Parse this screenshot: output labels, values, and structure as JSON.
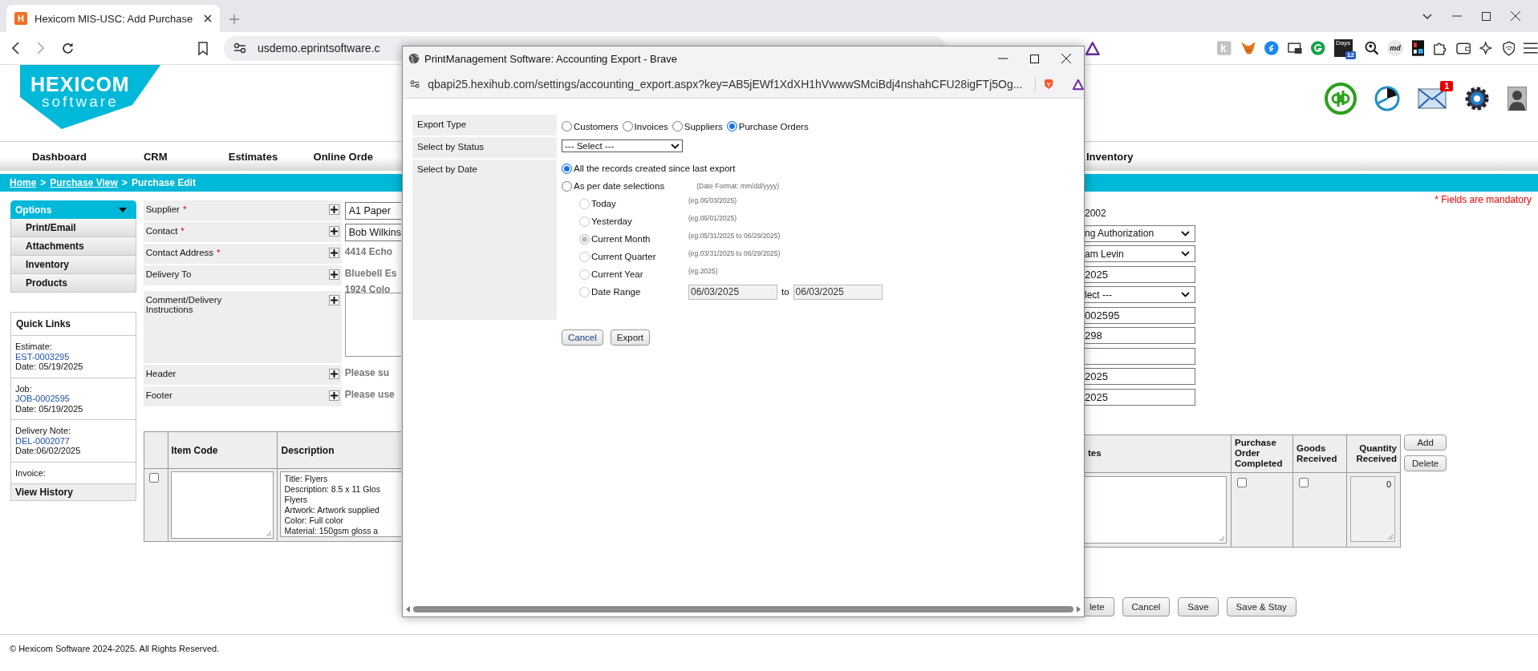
{
  "browser": {
    "tab": {
      "favicon_letter": "H",
      "title": "Hexicom MIS-USC: Add Purchase"
    },
    "address": "usdemo.eprintsoftware.c",
    "extensions": {
      "days_text": "Days",
      "days_badge": "12",
      "md_text": "md"
    }
  },
  "header": {
    "logo_line1": "HEXICOM",
    "logo_line2": "software",
    "mail_badge": "1"
  },
  "nav": [
    {
      "label": "Dashboard"
    },
    {
      "label": "CRM"
    },
    {
      "label": "Estimates"
    },
    {
      "label": "Online Orde"
    },
    {
      "label": "Inventory"
    }
  ],
  "breadcrumb": {
    "separator": ">",
    "items": [
      {
        "label": "Home",
        "link": true
      },
      {
        "label": "Purchase View",
        "link": true
      },
      {
        "label": "Purchase Edit",
        "link": false
      }
    ]
  },
  "options": {
    "title": "Options",
    "items": [
      "Print/Email",
      "Attachments",
      "Inventory",
      "Products"
    ]
  },
  "quick_links": {
    "title": "Quick Links",
    "entries": [
      {
        "label": "Estimate:",
        "link": "EST-0003295",
        "date": "Date: 05/19/2025"
      },
      {
        "label": "Job:",
        "link": "JOB-0002595",
        "date": "Date: 05/19/2025"
      },
      {
        "label": "Delivery Note:",
        "link": "DEL-0002077",
        "date": "Date:06/02/2025"
      },
      {
        "label": "Invoice:"
      }
    ],
    "footer": "View History"
  },
  "form": {
    "required_mark": "*",
    "rows": [
      {
        "label": "Supplier",
        "required": true,
        "kind": "input",
        "value": "A1 Paper"
      },
      {
        "label": "Contact",
        "required": true,
        "kind": "input",
        "value": "Bob Wilkins"
      },
      {
        "label": "Contact Address",
        "required": true,
        "kind": "text",
        "lines": [
          "4414 Echo"
        ]
      },
      {
        "label": "Delivery To",
        "required": false,
        "kind": "text",
        "lines": [
          "Bluebell Es",
          "1924 Colo"
        ]
      },
      {
        "label": "Comment/Delivery Instructions",
        "required": false,
        "kind": "textarea"
      },
      {
        "label": "Header",
        "required": false,
        "kind": "hint",
        "lines": [
          "Please su"
        ]
      },
      {
        "label": "Footer",
        "required": false,
        "kind": "hint",
        "lines": [
          "Please use"
        ]
      }
    ]
  },
  "mandatory_note": "* Fields are mandatory",
  "right_fields": [
    {
      "kind": "text",
      "value": "2002"
    },
    {
      "kind": "select",
      "value": "ng Authorization"
    },
    {
      "kind": "select",
      "value": "am Levin"
    },
    {
      "kind": "input",
      "value": "2025"
    },
    {
      "kind": "select",
      "value": "lect ---"
    },
    {
      "kind": "input",
      "value": "002595"
    },
    {
      "kind": "input",
      "value": "298"
    },
    {
      "kind": "input"
    },
    {
      "kind": "input",
      "value": "2025"
    },
    {
      "kind": "input",
      "value": "2025"
    }
  ],
  "items_table": {
    "columns_left": [
      "Item Code",
      "Description"
    ],
    "columns_right": [
      "tes",
      "Purchase Order Completed",
      "Goods Received",
      "Quantity Received"
    ],
    "rows": [
      {
        "selected": false,
        "description_lines": [
          "Title: Flyers",
          "Description: 8.5 x 11 Glos",
          "Flyers",
          "Artwork: Artwork supplied",
          "Color: Full color",
          "Material: 150gsm gloss a"
        ],
        "po_completed": false,
        "goods_received": false,
        "quantity_received": "0"
      }
    ],
    "buttons": [
      "Add",
      "Delete"
    ]
  },
  "page_buttons": [
    "lete",
    "Cancel",
    "Save",
    "Save & Stay"
  ],
  "footer": "© Hexicom Software 2024-2025. All Rights Reserved.",
  "popup": {
    "title": "PrintManagement Software: Accounting Export - Brave",
    "url": "qbapi25.hexihub.com/settings/accounting_export.aspx?key=AB5jEWf1XdXH1hVwwwSMciBdj4nshahCFU28igFTj5Og...",
    "export_type": {
      "label": "Export Type",
      "options": [
        {
          "label": "Customers",
          "selected": false
        },
        {
          "label": "Invoices",
          "selected": false
        },
        {
          "label": "Suppliers",
          "selected": false
        },
        {
          "label": "Purchase Orders",
          "selected": true
        }
      ]
    },
    "status": {
      "label": "Select by Status",
      "value": "--- Select ---"
    },
    "date": {
      "label": "Select by Date",
      "modes": [
        {
          "label": "All the records created since last export",
          "selected": true
        },
        {
          "label": "As per date selections",
          "selected": false,
          "hint": "(Date Format: mm/dd/yyyy)"
        }
      ],
      "periods": [
        {
          "label": "Today",
          "hint": "(eg.06/03/2025)",
          "selected": false,
          "disabled": true
        },
        {
          "label": "Yesterday",
          "hint": "(eg.06/01/2025)",
          "selected": false,
          "disabled": true
        },
        {
          "label": "Current Month",
          "hint": "(eg.05/31/2025 to 06/29/2025)",
          "selected": true,
          "disabled": true
        },
        {
          "label": "Current Quarter",
          "hint": "(eg.03/31/2025 to 06/29/2025)",
          "selected": false,
          "disabled": true
        },
        {
          "label": "Current Year",
          "hint": "(eg.2025)",
          "selected": false,
          "disabled": true
        },
        {
          "label": "Date Range",
          "selected": false,
          "disabled": true,
          "from": "06/03/2025",
          "to_label": "to",
          "to": "06/03/2025"
        }
      ]
    },
    "buttons": [
      "Cancel",
      "Export"
    ]
  }
}
